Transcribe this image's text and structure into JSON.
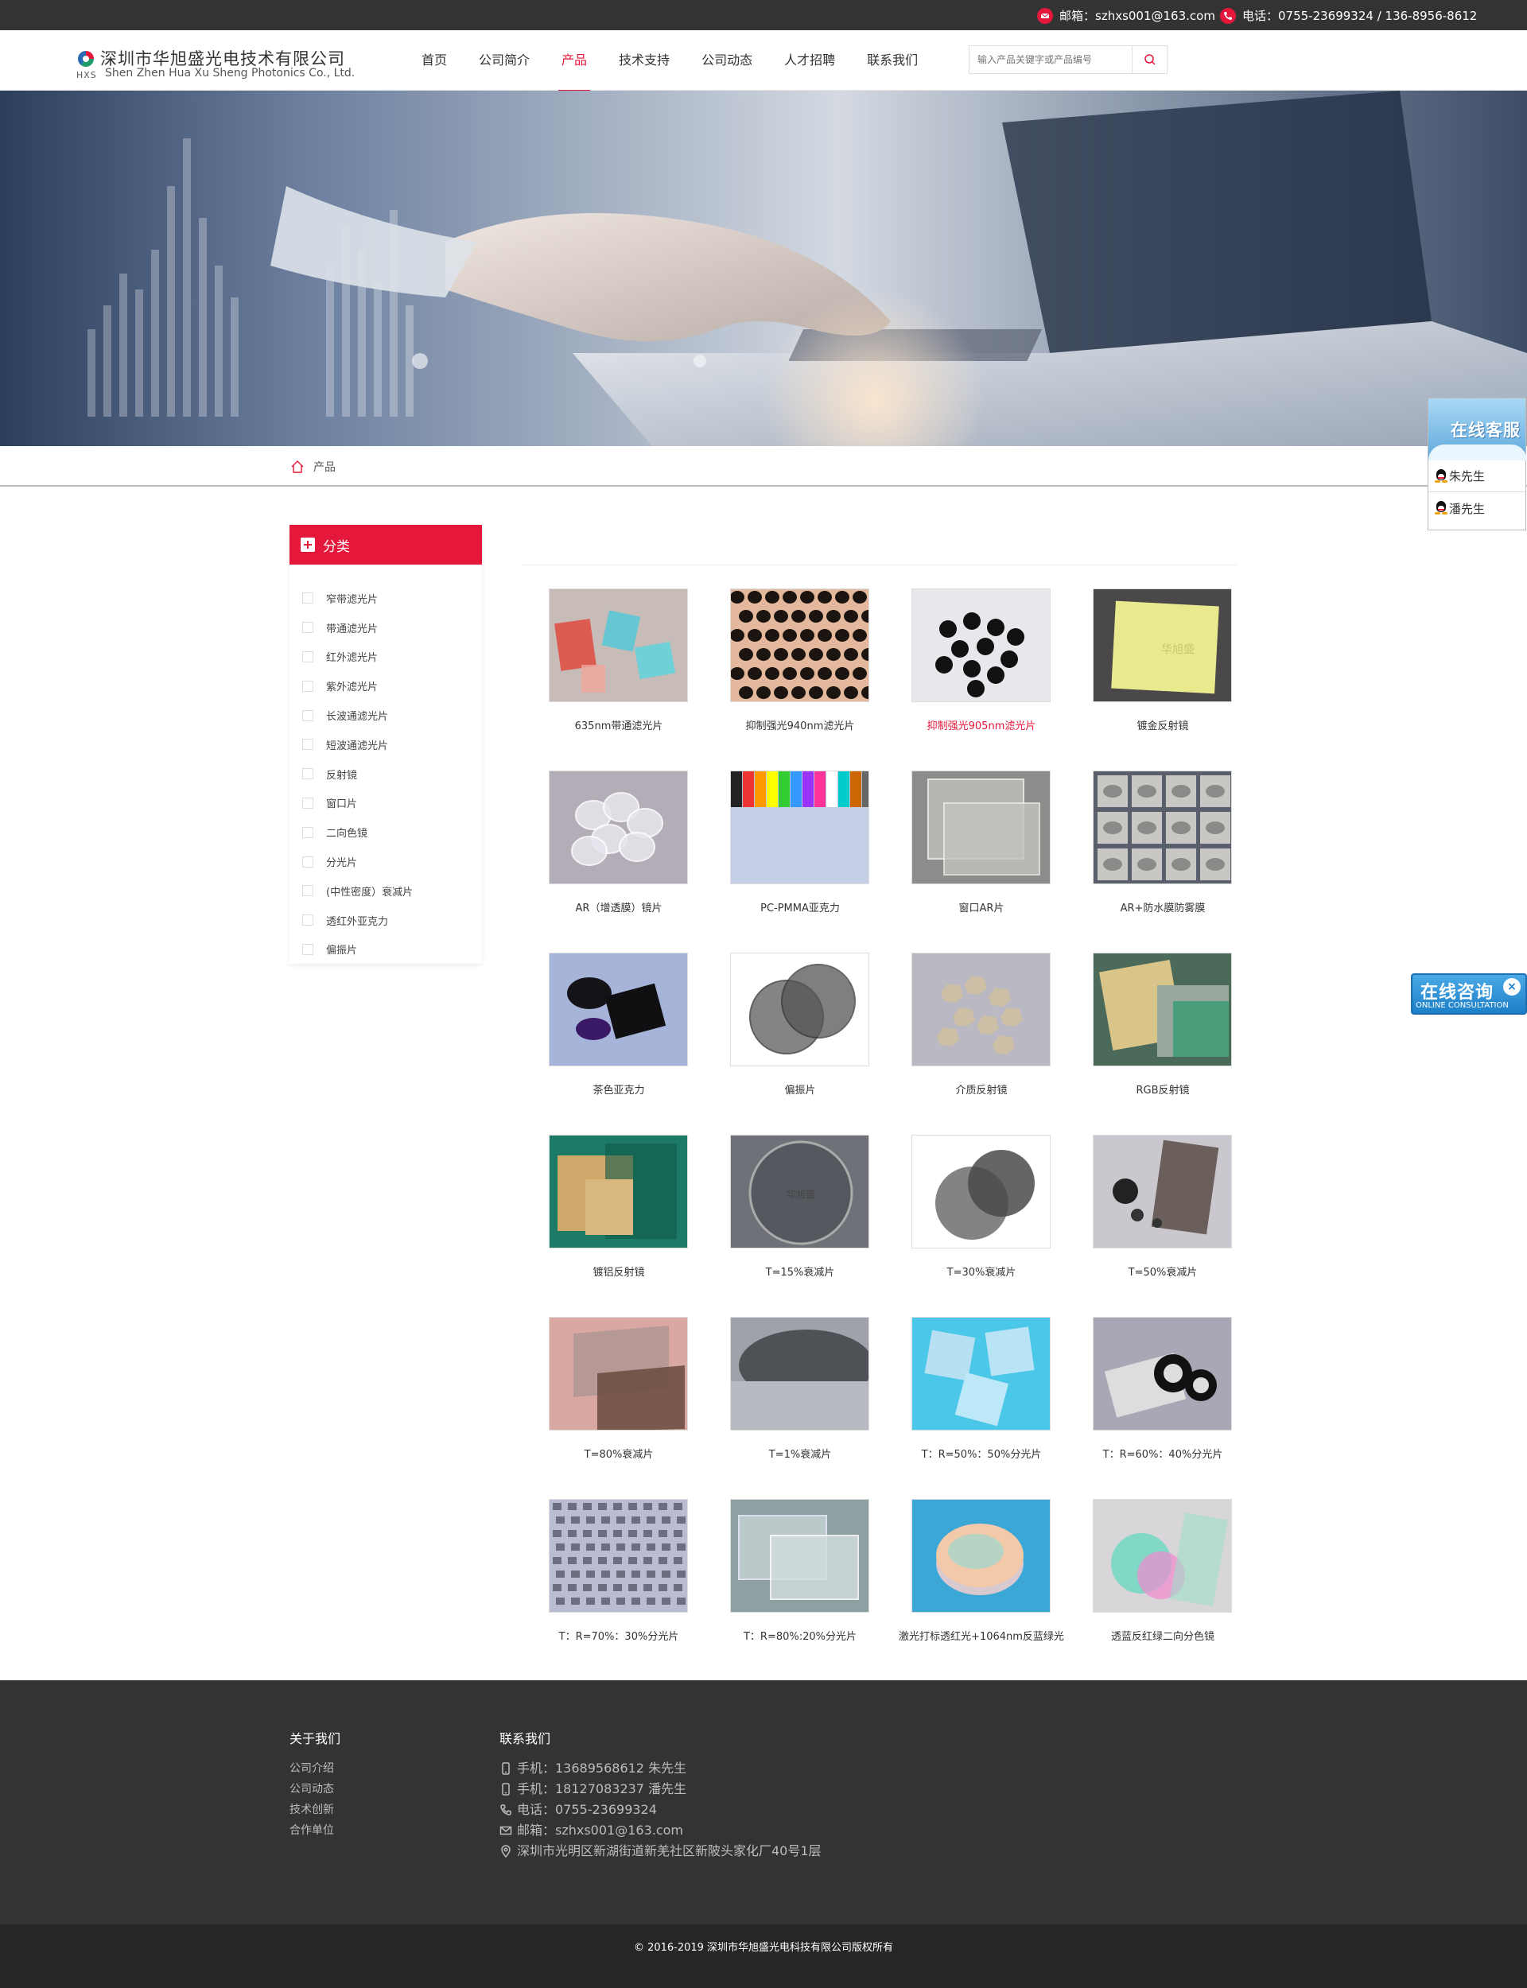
{
  "topbar": {
    "email": "邮箱：szhxs001@163.com",
    "phone": "电话：0755-23699324 / 136-8956-8612"
  },
  "header": {
    "company_cn": "深圳市华旭盛光电技术有限公司",
    "company_abbr": "HXS",
    "company_en": "Shen Zhen Hua Xu Sheng Photonics Co., Ltd.",
    "nav": [
      "首页",
      "公司简介",
      "产品",
      "技术支持",
      "公司动态",
      "人才招聘",
      "联系我们"
    ],
    "active_nav": "产品",
    "search_placeholder": "输入产品关键字或产品编号"
  },
  "breadcrumb": {
    "current": "产品"
  },
  "sidebar": {
    "title": "分类",
    "items": [
      "窄带滤光片",
      "带通滤光片",
      "红外滤光片",
      "紫外滤光片",
      "长波通滤光片",
      "短波通滤光片",
      "反射镜",
      "窗口片",
      "二向色镜",
      "分光片",
      "(中性密度）衰减片",
      "透红外亚克力",
      "偏振片"
    ]
  },
  "products": [
    {
      "title": "635nm带通滤光片",
      "image": "red-cyan-filters"
    },
    {
      "title": "抑制强光940nm滤光片",
      "image": "black-disc-array"
    },
    {
      "title": "抑制强光905nm滤光片",
      "image": "black-dots-white"
    },
    {
      "title": "镀金反射镜",
      "image": "yellow-plate"
    },
    {
      "title": "AR（增透膜）镜片",
      "image": "clear-lenses"
    },
    {
      "title": "PC-PMMA亚克力",
      "image": "colored-acrylic"
    },
    {
      "title": "窗口AR片",
      "image": "glass-window"
    },
    {
      "title": "AR+防水膜防雾膜",
      "image": "coated-samples"
    },
    {
      "title": "茶色亚克力",
      "image": "dark-acrylic"
    },
    {
      "title": "偏振片",
      "image": "polarizer-discs"
    },
    {
      "title": "介质反射镜",
      "image": "dielectric-mirrors"
    },
    {
      "title": "RGB反射镜",
      "image": "rgb-mirror"
    },
    {
      "title": "镀铝反射镜",
      "image": "aluminum-mirror"
    },
    {
      "title": "T=15%衰减片",
      "image": "gray-disc"
    },
    {
      "title": "T=30%衰减片",
      "image": "gray-overlap-discs"
    },
    {
      "title": "T=50%衰减片",
      "image": "nd-assorted"
    },
    {
      "title": "T=80%衰减片",
      "image": "brown-plate"
    },
    {
      "title": "T=1%衰减片",
      "image": "dark-disc"
    },
    {
      "title": "T：R=50%：50%分光片",
      "image": "blue-squares"
    },
    {
      "title": "T：R=60%：40%分光片",
      "image": "ring-plates"
    },
    {
      "title": "T：R=70%：30%分光片",
      "image": "chip-array"
    },
    {
      "title": "T：R=80%:20%分光片",
      "image": "clear-plates"
    },
    {
      "title": "激光打标透红光+1064nm反蓝绿光",
      "image": "rainbow-cylinder"
    },
    {
      "title": "透蓝反红绿二向分色镜",
      "image": "dichroic-plates"
    }
  ],
  "highlighted_product": "抑制强光905nm滤光片",
  "float": {
    "kefu_title": "在线客服",
    "agents": [
      "朱先生",
      "潘先生"
    ],
    "consult_cn": "在线咨询",
    "consult_en": "ONLINE CONSULTATION",
    "consult_close": "×"
  },
  "footer": {
    "about_title": "关于我们",
    "about_links": [
      "公司介绍",
      "公司动态",
      "技术创新",
      "合作单位"
    ],
    "contact_title": "联系我们",
    "contact_lines": [
      {
        "icon": "mobile-icon",
        "text": "手机：13689568612 朱先生"
      },
      {
        "icon": "mobile-icon",
        "text": "手机：18127083237 潘先生"
      },
      {
        "icon": "phone-icon",
        "text": "电话：0755-23699324"
      },
      {
        "icon": "mail-icon",
        "text": "邮箱：szhxs001@163.com"
      },
      {
        "icon": "location-icon",
        "text": "深圳市光明区新湖街道新羌社区新陂头家化厂40号1层"
      }
    ],
    "copyright": "© 2016-2019 深圳市华旭盛光电科技有限公司版权所有"
  },
  "colors": {
    "accent": "#e5173a",
    "topbar_bg": "#333333",
    "footer_bg": "#333333",
    "copyright_bg": "#262626"
  }
}
